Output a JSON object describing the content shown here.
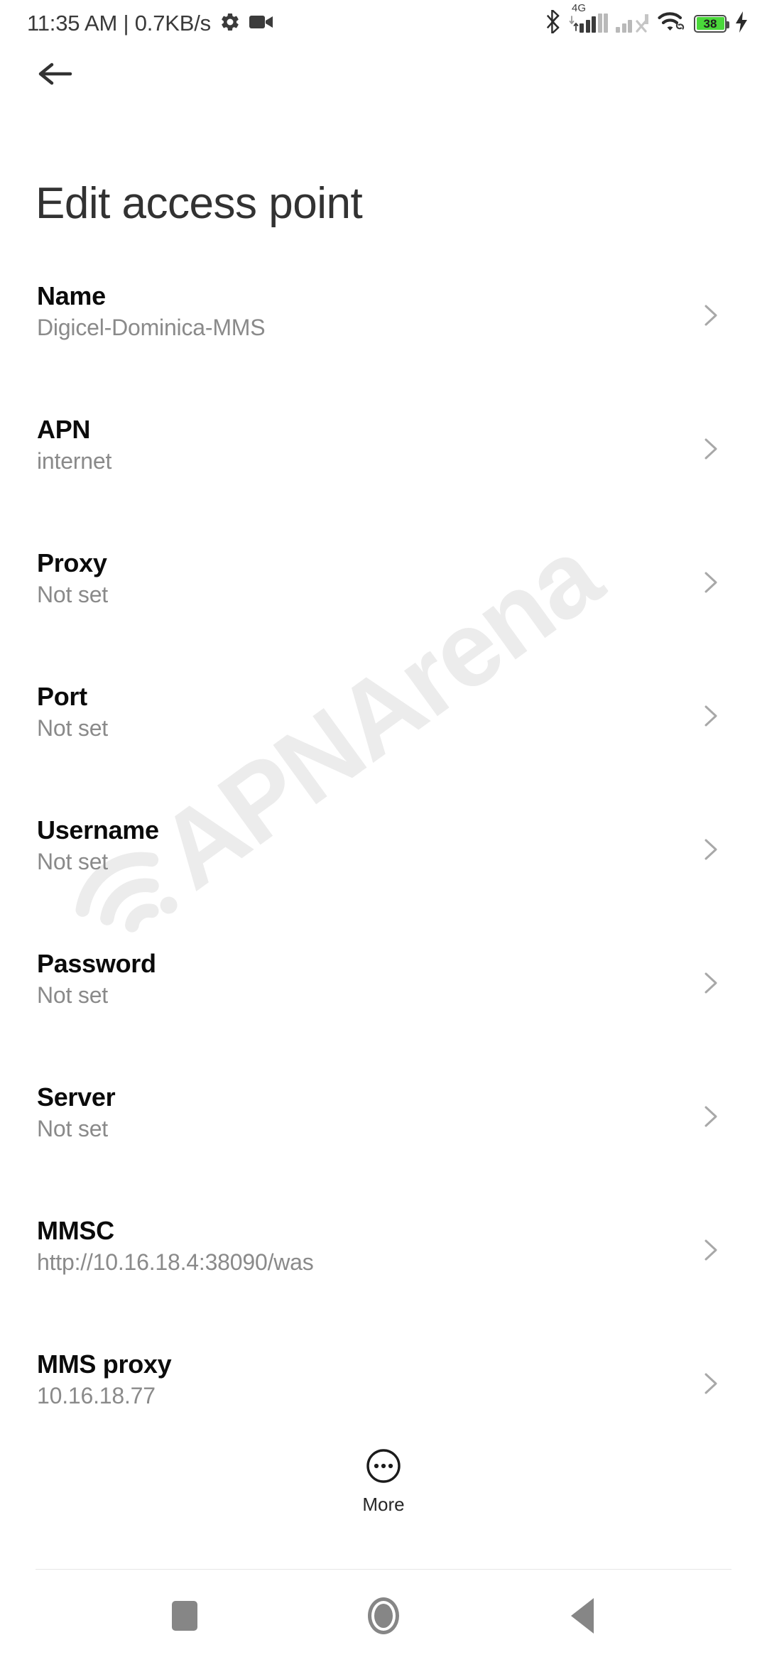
{
  "status_bar": {
    "clock": "11:35 AM | 0.7KB/s",
    "settings_icon": "gear-icon",
    "recorder_icon": "video-camera-icon",
    "bluetooth_icon": "bluetooth-icon",
    "sim1_network_label": "4G",
    "sim1_icon": "cellular-signal-icon",
    "sim2_icon": "cellular-signal-no-service-icon",
    "wifi_icon": "wifi-icon",
    "battery_level": "38",
    "battery_icon": "battery-icon",
    "charging_icon": "charging-bolt-icon",
    "battery_color": "#4ad83a"
  },
  "header": {
    "back_icon": "back-arrow-icon",
    "title": "Edit access point"
  },
  "watermark": {
    "text": "APNArena",
    "icon": "wifi-arc-icon",
    "color": "#ececec"
  },
  "settings": {
    "chevron_icon": "chevron-right-icon",
    "rows": [
      {
        "label": "Name",
        "value": "Digicel-Dominica-MMS"
      },
      {
        "label": "APN",
        "value": "internet"
      },
      {
        "label": "Proxy",
        "value": "Not set"
      },
      {
        "label": "Port",
        "value": "Not set"
      },
      {
        "label": "Username",
        "value": "Not set"
      },
      {
        "label": "Password",
        "value": "Not set"
      },
      {
        "label": "Server",
        "value": "Not set"
      },
      {
        "label": "MMSC",
        "value": "http://10.16.18.4:38090/was"
      },
      {
        "label": "MMS proxy",
        "value": "10.16.18.77"
      }
    ]
  },
  "more_button": {
    "label": "More",
    "icon": "more-circle-icon"
  },
  "nav_bar": {
    "recents_icon": "recents-square-icon",
    "home_icon": "home-circle-icon",
    "back_icon": "back-triangle-icon",
    "color": "#868686"
  }
}
